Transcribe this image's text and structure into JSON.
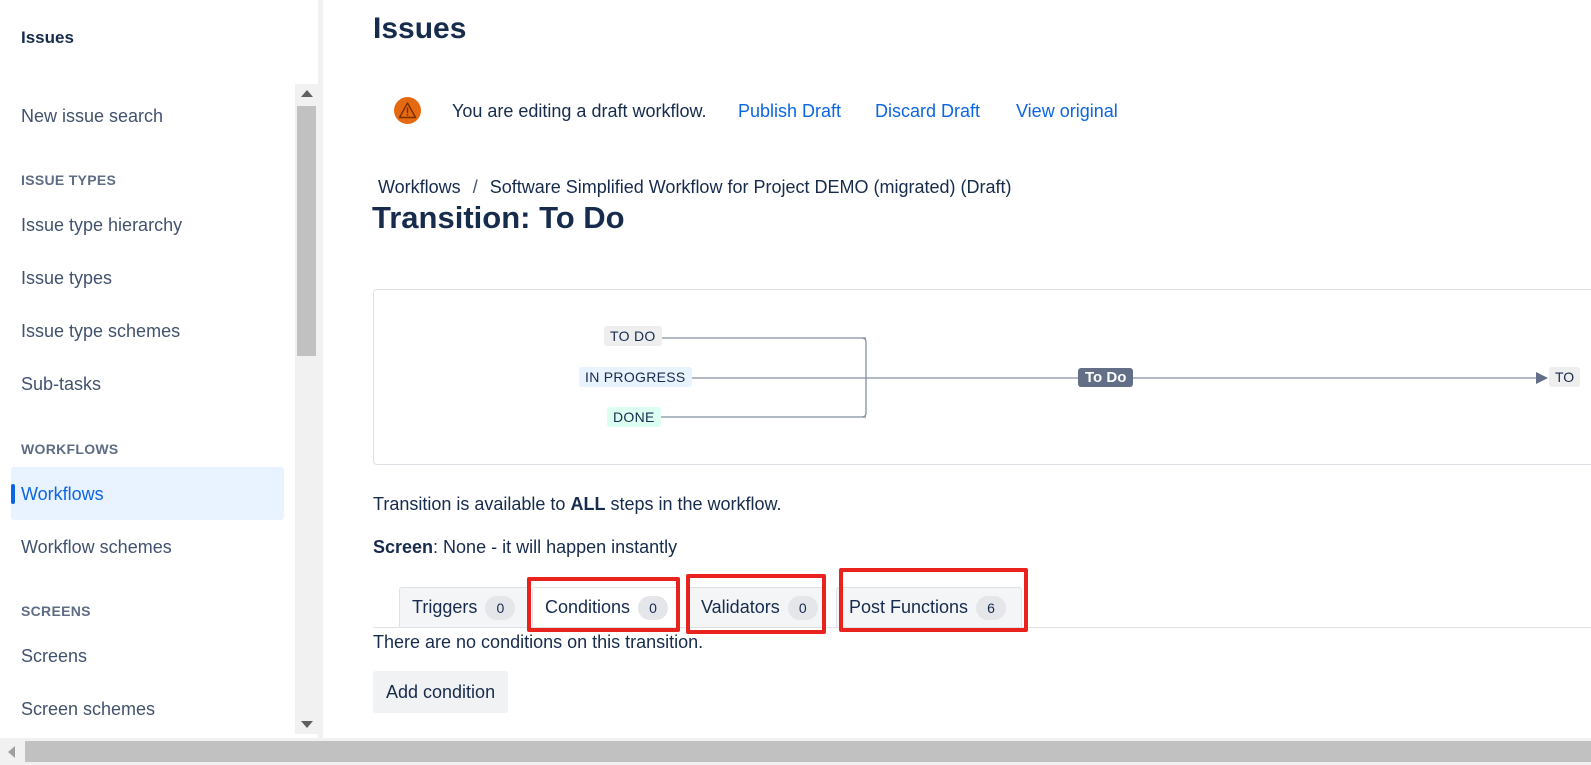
{
  "sidebar": {
    "title": "Issues",
    "new_issue_search": "New issue search",
    "sections": {
      "issue_types": "ISSUE TYPES",
      "workflows": "WORKFLOWS",
      "screens": "SCREENS"
    },
    "items": {
      "issue_type_hierarchy": "Issue type hierarchy",
      "issue_types": "Issue types",
      "issue_type_schemes": "Issue type schemes",
      "sub_tasks": "Sub-tasks",
      "workflows": "Workflows",
      "workflow_schemes": "Workflow schemes",
      "screens": "Screens",
      "screen_schemes": "Screen schemes"
    },
    "active_item": "Workflows"
  },
  "header": {
    "title": "Issues"
  },
  "draft_banner": {
    "icon": "warning-icon",
    "message": "You are editing a draft workflow.",
    "publish": "Publish Draft",
    "discard": "Discard Draft",
    "view_original": "View original"
  },
  "breadcrumb": {
    "root": "Workflows",
    "separator": "/",
    "current": "Software Simplified Workflow for Project DEMO (migrated) (Draft)"
  },
  "transition_title": "Transition: To Do",
  "diagram": {
    "from_statuses": [
      "TO DO",
      "IN PROGRESS",
      "DONE"
    ],
    "transition": "To Do",
    "target_status_partial": "TO"
  },
  "availability": {
    "prefix": "Transition is available to",
    "emphasis": "ALL",
    "suffix": "steps in the workflow."
  },
  "screen": {
    "label": "Screen",
    "value": ": None - it will happen instantly"
  },
  "tabs": [
    {
      "label": "Triggers",
      "count": "0"
    },
    {
      "label": "Conditions",
      "count": "0"
    },
    {
      "label": "Validators",
      "count": "0"
    },
    {
      "label": "Post Functions",
      "count": "6"
    }
  ],
  "active_tab": "Conditions",
  "conditions": {
    "empty_message": "There are no conditions on this transition.",
    "add_button": "Add condition"
  },
  "colors": {
    "link": "#0c66e4",
    "warning": "#e56910",
    "highlight": "#e8231d",
    "transition_label_bg": "#626f86"
  }
}
